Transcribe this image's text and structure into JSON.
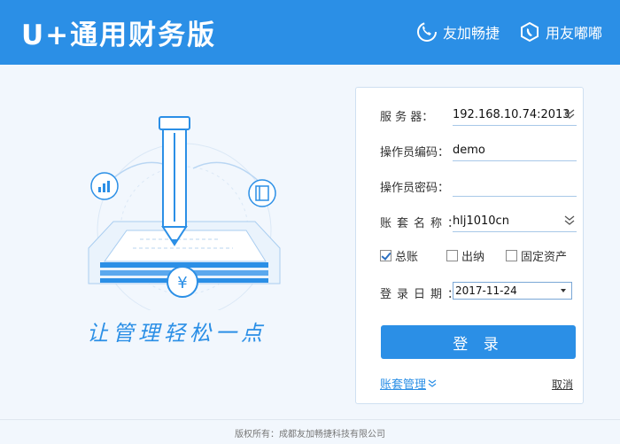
{
  "header": {
    "brand": "U+通用财务版",
    "link_youjia": "友加畅捷",
    "link_dudu": "用友嘟嘟"
  },
  "slogan": "让管理轻松一点",
  "illustration": {
    "currency_symbol": "¥"
  },
  "login": {
    "server_label": "服 务 器：",
    "server_value": "192.168.10.74:2013",
    "operator_id_label": "操作员编码：",
    "operator_id_value": "demo",
    "password_label": "操作员密码：",
    "password_value": "",
    "account_set_label": "账套名称：",
    "account_set_value": "hlj1010cn",
    "modules": [
      {
        "label": "总账",
        "checked": true
      },
      {
        "label": "出纳",
        "checked": false
      },
      {
        "label": "固定资产",
        "checked": false
      }
    ],
    "login_date_label": "登录日期：",
    "login_date_value": "2017-11-24",
    "login_button": "登 录",
    "account_mgmt_link": "账套管理",
    "cancel_link": "取消"
  },
  "footer": {
    "copyright": "版权所有：成都友加畅捷科技有限公司"
  },
  "colors": {
    "accent": "#2b8fe6",
    "background": "#f2f7fd"
  },
  "icons": [
    "phone-icon",
    "dudu-icon",
    "pen-icon",
    "chart-icon",
    "book-icon",
    "chevron-down-icon"
  ]
}
